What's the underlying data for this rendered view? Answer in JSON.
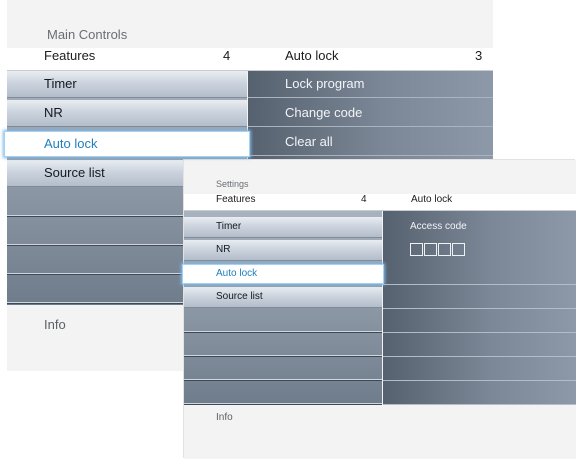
{
  "main": {
    "title": "Main Controls",
    "header_left": "Features",
    "header_count": "4",
    "header_right": "Auto lock",
    "header_right_count": "3",
    "left_items": [
      "Timer",
      "NR",
      "Auto lock",
      "Source list"
    ],
    "selected_index": 2,
    "right_items": [
      "Lock program",
      "Change code",
      "Clear all"
    ],
    "info": "Info"
  },
  "settings": {
    "title": "Settings",
    "header_left": "Features",
    "header_count": "4",
    "header_right": "Auto lock",
    "left_items": [
      "Timer",
      "NR",
      "Auto lock",
      "Source list"
    ],
    "selected_index": 2,
    "right_label": "Access code",
    "info": "Info"
  },
  "colors": {
    "accent_text": "#1f7fbd",
    "selection_glow": "#7fb8e6"
  }
}
